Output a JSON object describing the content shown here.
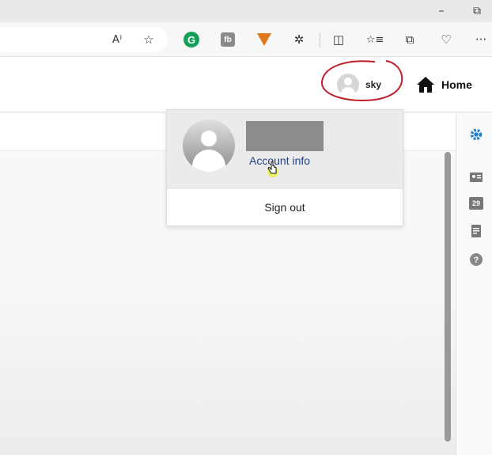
{
  "window": {
    "minimize": "–",
    "maximize": "⧉"
  },
  "toolbar": {
    "read_aloud_icon": "A⁾",
    "favorite_icon": "☆",
    "ext_grammarly": "G",
    "ext_fb": "fb",
    "extensions_icon": "✲",
    "split_icon": "◫",
    "favorites_icon": "☆≡",
    "collections_icon": "⧉",
    "health_icon": "♡",
    "more_icon": "···"
  },
  "header": {
    "user_name": "sky",
    "home_label": "Home"
  },
  "dropdown": {
    "account_link": "Account info",
    "sign_out": "Sign out"
  },
  "rail": {
    "calendar_day": "29"
  },
  "colors": {
    "accent": "#1f7fce",
    "annotation": "#c0202a",
    "link": "#1f3f86"
  }
}
